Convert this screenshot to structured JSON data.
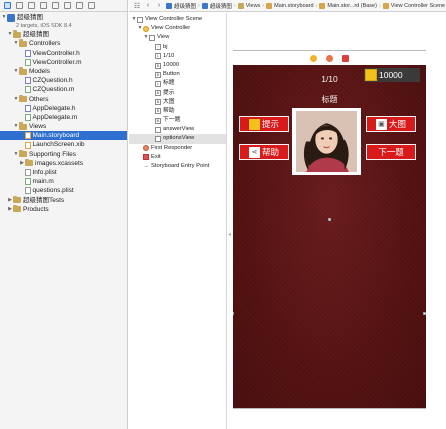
{
  "navigator": {
    "project_name": "超级猜图",
    "project_subtitle": "2 targets, iOS SDK 8.4",
    "items": [
      {
        "label": "超级猜图",
        "kind": "folder",
        "indent": 1,
        "open": true
      },
      {
        "label": "Controllers",
        "kind": "folder",
        "indent": 2,
        "open": true
      },
      {
        "label": "ViewController.h",
        "kind": "h",
        "indent": 3
      },
      {
        "label": "ViewController.m",
        "kind": "m",
        "indent": 3
      },
      {
        "label": "Models",
        "kind": "folder",
        "indent": 2,
        "open": true
      },
      {
        "label": "CZQuestion.h",
        "kind": "h",
        "indent": 3
      },
      {
        "label": "CZQuestion.m",
        "kind": "m",
        "indent": 3
      },
      {
        "label": "Others",
        "kind": "folder",
        "indent": 2,
        "open": true
      },
      {
        "label": "AppDelegate.h",
        "kind": "h",
        "indent": 3
      },
      {
        "label": "AppDelegate.m",
        "kind": "m",
        "indent": 3
      },
      {
        "label": "Views",
        "kind": "folder",
        "indent": 2,
        "open": true
      },
      {
        "label": "Main.storyboard",
        "kind": "sb",
        "indent": 3,
        "selected": true
      },
      {
        "label": "LaunchScreen.xib",
        "kind": "sb",
        "indent": 3
      },
      {
        "label": "Supporting Files",
        "kind": "folder",
        "indent": 2,
        "open": true
      },
      {
        "label": "images.xcassets",
        "kind": "folder",
        "indent": 3
      },
      {
        "label": "Info.plist",
        "kind": "file",
        "indent": 3
      },
      {
        "label": "main.m",
        "kind": "m",
        "indent": 3
      },
      {
        "label": "questions.plist",
        "kind": "file",
        "indent": 3
      },
      {
        "label": "超级猜图Tests",
        "kind": "folder",
        "indent": 1,
        "open": false
      },
      {
        "label": "Products",
        "kind": "folder",
        "indent": 1,
        "open": false
      }
    ]
  },
  "jumpbar": {
    "crumbs": [
      "超级猜图",
      "超级猜图",
      "Views",
      "Main.storyboard",
      "Main.stor...rd (Base)",
      "View Controller Scene"
    ]
  },
  "outline": {
    "items": [
      {
        "label": "View Controller Scene",
        "kind": "scene",
        "indent": 0,
        "open": true
      },
      {
        "label": "View Controller",
        "kind": "vc",
        "indent": 1,
        "open": true
      },
      {
        "label": "View",
        "kind": "view",
        "indent": 2,
        "open": true
      },
      {
        "label": "bj",
        "kind": "img",
        "indent": 3
      },
      {
        "label": "1/10",
        "kind": "lbl",
        "indent": 3
      },
      {
        "label": "10000",
        "kind": "btn",
        "indent": 3
      },
      {
        "label": "Button",
        "kind": "btn",
        "indent": 3
      },
      {
        "label": "标题",
        "kind": "lbl",
        "indent": 3
      },
      {
        "label": "提示",
        "kind": "btn",
        "indent": 3
      },
      {
        "label": "大图",
        "kind": "btn",
        "indent": 3
      },
      {
        "label": "帮助",
        "kind": "btn",
        "indent": 3
      },
      {
        "label": "下一题",
        "kind": "btn",
        "indent": 3
      },
      {
        "label": "answerView",
        "kind": "view",
        "indent": 3
      },
      {
        "label": "optionsView",
        "kind": "view",
        "indent": 3,
        "highlighted": true
      },
      {
        "label": "First Responder",
        "kind": "fr",
        "indent": 1
      },
      {
        "label": "Exit",
        "kind": "ex",
        "indent": 1
      },
      {
        "label": "Storyboard Entry Point",
        "kind": "arrow",
        "indent": 1
      }
    ]
  },
  "scene": {
    "question_number": "1/10",
    "coins": "10000",
    "title": "标题",
    "buttons": {
      "hint": "提示",
      "zoom": "大图",
      "help": "帮助",
      "next": "下一题"
    }
  },
  "colors": {
    "background": "#561212",
    "button_red": "#d81a1a",
    "coin_yellow": "#f2c21b",
    "selection_blue": "#2f6fd0"
  }
}
